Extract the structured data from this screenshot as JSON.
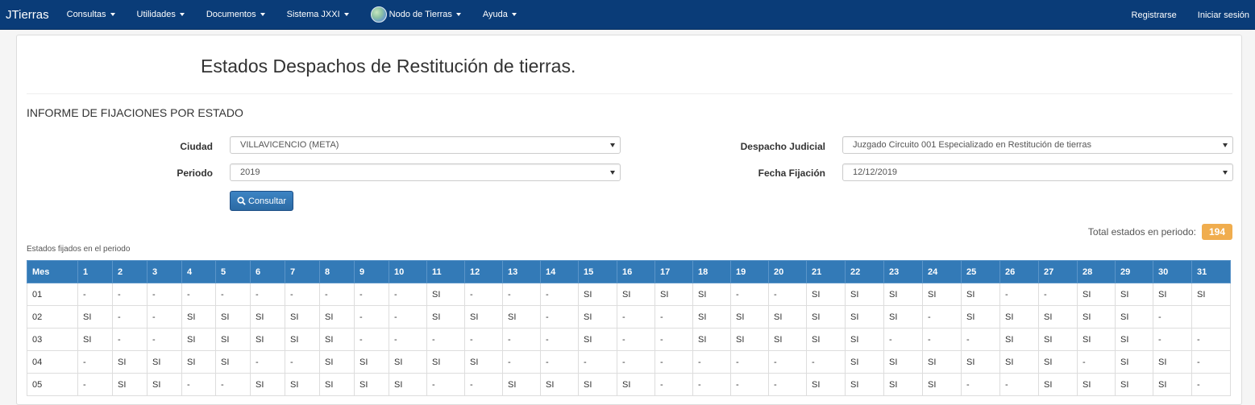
{
  "navbar": {
    "brand": "JTierras",
    "items": [
      {
        "label": "Consultas"
      },
      {
        "label": "Utilidades"
      },
      {
        "label": "Documentos"
      },
      {
        "label": "Sistema JXXI"
      },
      {
        "label": "Nodo de Tierras"
      },
      {
        "label": "Ayuda"
      }
    ],
    "register": "Registrarse",
    "login": "Iniciar sesión"
  },
  "page": {
    "title": "Estados Despachos de Restitución de tierras.",
    "section": "INFORME DE FIJACIONES POR ESTADO"
  },
  "form": {
    "ciudad_label": "Ciudad",
    "ciudad_value": "VILLAVICENCIO (META)",
    "periodo_label": "Periodo",
    "periodo_value": "2019",
    "despacho_label": "Despacho Judicial",
    "despacho_value": "Juzgado Circuito 001 Especializado en Restitución de tierras",
    "fecha_label": "Fecha Fijación",
    "fecha_value": "12/12/2019",
    "consultar_label": "Consultar"
  },
  "summary": {
    "total_label": "Total estados en periodo:",
    "total_value": "194",
    "caption": "Estados fijados en el periodo"
  },
  "table": {
    "headers": [
      "Mes",
      "1",
      "2",
      "3",
      "4",
      "5",
      "6",
      "7",
      "8",
      "9",
      "10",
      "11",
      "12",
      "13",
      "14",
      "15",
      "16",
      "17",
      "18",
      "19",
      "20",
      "21",
      "22",
      "23",
      "24",
      "25",
      "26",
      "27",
      "28",
      "29",
      "30",
      "31"
    ],
    "rows": [
      [
        "01",
        "-",
        "-",
        "-",
        "-",
        "-",
        "-",
        "-",
        "-",
        "-",
        "-",
        "SI",
        "-",
        "-",
        "-",
        "SI",
        "SI",
        "SI",
        "SI",
        "-",
        "-",
        "SI",
        "SI",
        "SI",
        "SI",
        "SI",
        "-",
        "-",
        "SI",
        "SI",
        "SI",
        "SI"
      ],
      [
        "02",
        "SI",
        "-",
        "-",
        "SI",
        "SI",
        "SI",
        "SI",
        "SI",
        "-",
        "-",
        "SI",
        "SI",
        "SI",
        "-",
        "SI",
        "-",
        "-",
        "SI",
        "SI",
        "SI",
        "SI",
        "SI",
        "SI",
        "-",
        "SI",
        "SI",
        "SI",
        "SI",
        "SI",
        "-",
        ""
      ],
      [
        "03",
        "SI",
        "-",
        "-",
        "SI",
        "SI",
        "SI",
        "SI",
        "SI",
        "-",
        "-",
        "-",
        "-",
        "-",
        "-",
        "SI",
        "-",
        "-",
        "SI",
        "SI",
        "SI",
        "SI",
        "SI",
        "-",
        "-",
        "-",
        "SI",
        "SI",
        "SI",
        "SI",
        "-",
        "-"
      ],
      [
        "04",
        "-",
        "SI",
        "SI",
        "SI",
        "SI",
        "-",
        "-",
        "SI",
        "SI",
        "SI",
        "SI",
        "SI",
        "-",
        "-",
        "-",
        "-",
        "-",
        "-",
        "-",
        "-",
        "-",
        "SI",
        "SI",
        "SI",
        "SI",
        "SI",
        "SI",
        "-",
        "SI",
        "SI",
        "-"
      ],
      [
        "05",
        "-",
        "SI",
        "SI",
        "-",
        "-",
        "SI",
        "SI",
        "SI",
        "SI",
        "SI",
        "-",
        "-",
        "SI",
        "SI",
        "SI",
        "SI",
        "-",
        "-",
        "-",
        "-",
        "SI",
        "SI",
        "SI",
        "SI",
        "-",
        "-",
        "SI",
        "SI",
        "SI",
        "SI",
        "-"
      ]
    ]
  },
  "colors": {
    "navbar": "#0a3c78",
    "table_header": "#337ab7",
    "badge": "#f0ad4e"
  }
}
